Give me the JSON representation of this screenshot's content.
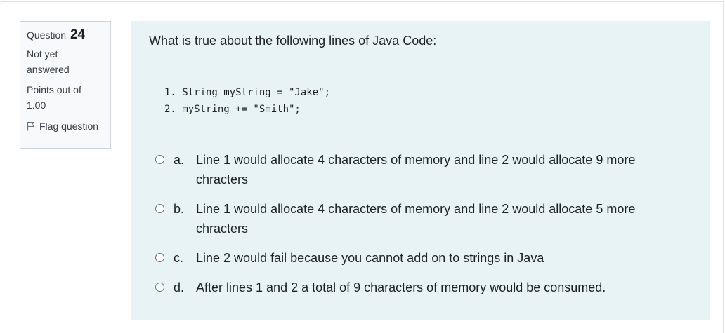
{
  "question_info": {
    "label": "Question",
    "number": "24",
    "state_line1": "Not yet",
    "state_line2": "answered",
    "grade_line1": "Points out of",
    "grade_line2": "1.00",
    "flag_label": "Flag question",
    "flag_icon": "flag-icon"
  },
  "question": {
    "text": "What is true about the following lines of Java Code:",
    "code_lines": [
      "1. String myString = \"Jake\";",
      "2. myString += \"Smith\";"
    ],
    "answers": [
      {
        "letter": "a.",
        "text": "Line 1 would allocate 4 characters of memory and line 2 would allocate 9 more chracters"
      },
      {
        "letter": "b.",
        "text": "Line 1 would allocate 4 characters of memory and line 2 would allocate 5 more chracters"
      },
      {
        "letter": "c.",
        "text": "Line 2 would fail because you cannot add on to strings in Java"
      },
      {
        "letter": "d.",
        "text": "After lines 1 and 2 a total of 9 characters of memory would be consumed."
      }
    ]
  },
  "colors": {
    "content_background": "#e7f3f5",
    "info_background": "#f8f9fa"
  }
}
